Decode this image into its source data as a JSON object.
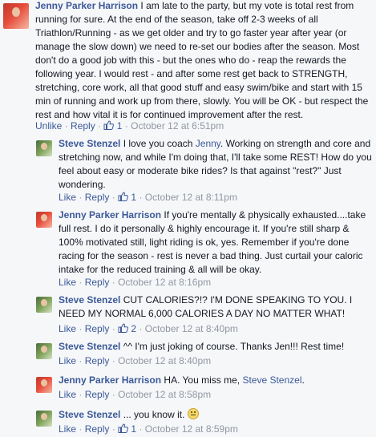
{
  "comments": [
    {
      "author": "Jenny Parker Harrison",
      "text": " I am late to the party, but my vote is total rest from running for sure. At the end of the season, take off 2-3 weeks of all Triathlon/Running - as we get older and try to go faster year after year (or manage the slow down) we need to re-set our bodies after the season. Most don't do a good job with this - but the ones who do - reap the rewards the following year. I would rest - and after some rest get back to STRENGTH, stretching, core work, all that good stuff and easy swim/bike and start with 15 min of running and work up from there, slowly. You will be OK - but respect the rest and how vital it is for continued improvement after the rest.",
      "action1": "Unlike",
      "action2": "Reply",
      "likes": "1",
      "timestamp": "October 12 at 6:51pm"
    },
    {
      "author": "Steve Stenzel",
      "text_before": " I love you coach ",
      "mention": "Jenny",
      "text_after": ". Working on strength and core and stretching now, and while I'm doing that, I'll take some REST! How do you feel about easy or moderate bike rides? Is that against \"rest?\" Just wondering.",
      "action1": "Like",
      "action2": "Reply",
      "likes": "1",
      "timestamp": "October 12 at 8:11pm"
    },
    {
      "author": "Jenny Parker Harrison",
      "text": " If you're mentally & physically exhausted....take full rest. I do it personally & highly encourage it. If you're still sharp & 100% motivated still, light riding is ok, yes. Remember if you're done racing for the season - rest is never a bad thing. Just curtail your caloric intake for the reduced training & all will be okay.",
      "action1": "Like",
      "action2": "Reply",
      "timestamp": "October 12 at 8:16pm"
    },
    {
      "author": "Steve Stenzel",
      "text": " CUT CALORIES?!? I'M DONE SPEAKING TO YOU. I NEED MY NORMAL 6,000 CALORIES A DAY NO MATTER WHAT!",
      "action1": "Like",
      "action2": "Reply",
      "likes": "2",
      "timestamp": "October 12 at 8:40pm"
    },
    {
      "author": "Steve Stenzel",
      "text": " ^^ I'm just joking of course. Thanks Jen!!! Rest time!",
      "action1": "Like",
      "action2": "Reply",
      "timestamp": "October 12 at 8:40pm"
    },
    {
      "author": "Jenny Parker Harrison",
      "text_before": " HA. You miss me, ",
      "mention": "Steve Stenzel",
      "text_after": ".",
      "action1": "Like",
      "action2": "Reply",
      "timestamp": "October 12 at 8:58pm"
    },
    {
      "author": "Steve Stenzel",
      "text": " ... you know it. ",
      "emoji": "smile-emoji",
      "action1": "Like",
      "action2": "Reply",
      "likes": "1",
      "timestamp": "October 12 at 8:59pm"
    }
  ],
  "separator": "·",
  "colors": {
    "link": "#3b5998",
    "meta_gray": "#9197a3",
    "text": "#141823",
    "background": "#f6f7f9"
  }
}
